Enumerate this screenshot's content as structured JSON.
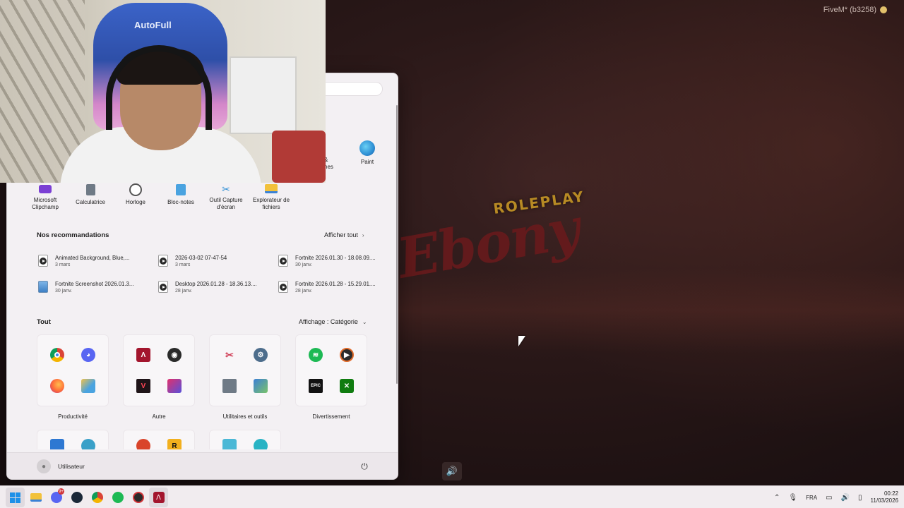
{
  "game": {
    "fivem_label": "FiveM* (b3258)",
    "logo_top": "ROLEPLAY",
    "logo_main": "Ebony"
  },
  "webcam": {
    "chair_brand": "AutoFull"
  },
  "start_menu": {
    "clipped_label": "&\nnes",
    "paint_label": "Paint",
    "pinned": [
      {
        "label": "Microsoft Clipchamp",
        "icon": "clipchamp-icon"
      },
      {
        "label": "Calculatrice",
        "icon": "calculator-icon"
      },
      {
        "label": "Horloge",
        "icon": "clock-icon"
      },
      {
        "label": "Bloc-notes",
        "icon": "notepad-icon"
      },
      {
        "label": "Outil Capture d'écran",
        "icon": "snipping-tool-icon"
      },
      {
        "label": "Explorateur de fichiers",
        "icon": "file-explorer-icon"
      }
    ],
    "recommendations_title": "Nos recommandations",
    "show_all": "Afficher tout",
    "recommendations": [
      {
        "name": "Animated Background, Blue,...",
        "date": "3 mars",
        "type": "video"
      },
      {
        "name": "2026-03-02 07-47-54",
        "date": "3 mars",
        "type": "video"
      },
      {
        "name": "Fortnite 2026.01.30 - 18.08.09....",
        "date": "30 janv.",
        "type": "video"
      },
      {
        "name": "Fortnite Screenshot 2026.01.3...",
        "date": "30 janv.",
        "type": "image"
      },
      {
        "name": "Desktop 2026.01.28 - 18.36.13....",
        "date": "28 janv.",
        "type": "video"
      },
      {
        "name": "Fortnite 2026.01.28 - 15.29.01....",
        "date": "28 janv.",
        "type": "video"
      }
    ],
    "all_title": "Tout",
    "view_mode": "Affichage : Catégorie",
    "categories": [
      {
        "label": "Productivité",
        "apps": [
          "chrome-icon",
          "discord-icon",
          "firefox-icon",
          "photos-icon"
        ]
      },
      {
        "label": "Autre",
        "apps": [
          "affinity-icon",
          "obs-icon",
          "valorant-icon",
          "social-apps-icon"
        ]
      },
      {
        "label": "Utilitaires et outils",
        "apps": [
          "snipping-tool-icon",
          "settings-icon",
          "calculator-icon",
          "control-panel-icon"
        ]
      },
      {
        "label": "Divertissement",
        "apps": [
          "spotify-icon",
          "media-player-icon",
          "epic-games-icon",
          "xbox-icon"
        ]
      }
    ],
    "user_name": "Utilisateur"
  },
  "taskbar": {
    "apps": [
      "windows-start-icon",
      "file-explorer-icon",
      "discord-icon",
      "steam-icon",
      "chrome-icon",
      "spotify-icon",
      "obs-icon",
      "affinity-icon"
    ],
    "discord_badge": "9+",
    "language": "FRA",
    "time": "00:22",
    "date": "11/03/2026"
  }
}
